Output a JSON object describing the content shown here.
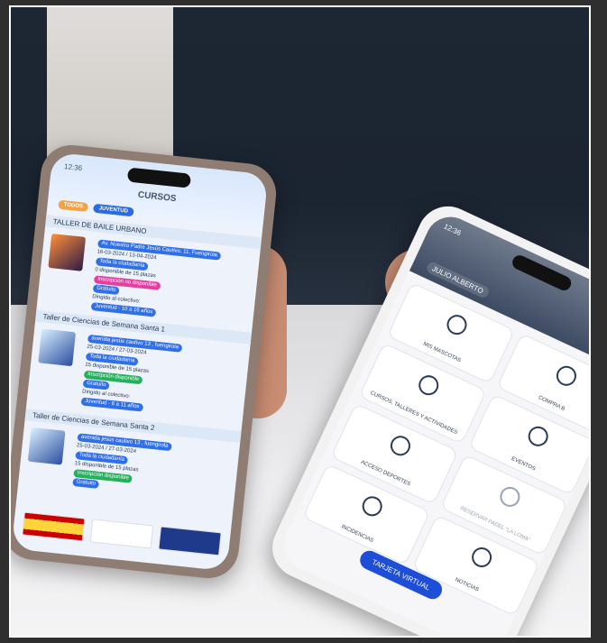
{
  "left_phone": {
    "status_time": "12:36",
    "screen_title": "CURSOS",
    "filters": [
      "TODOS",
      "JUVENTUD"
    ],
    "courses": [
      {
        "title": "TALLER DE BAILE URBANO",
        "location": "Av. Nuestro Padre Jesús Cautivo, 11, Fuengirola",
        "dates": "16-03-2024 / 13-04-2024",
        "audience": "Toda la ciudadanía",
        "places": "0 disponible de 15 plazas",
        "status": "Inscripción no disponible",
        "price": "Gratuito",
        "target_label": "Dirigido al colectivo:",
        "target_group": "Juventud - 10 a 16 años"
      },
      {
        "title": "Taller de Ciencias de Semana Santa 1",
        "location": "avenida jesús cautivo 13 , fuengirola",
        "dates": "25-03-2024 / 27-03-2024",
        "audience": "Toda la ciudadanía",
        "places": "15 disponible de 15 plazas",
        "status": "Inscripción disponible",
        "price": "Gratuito",
        "target_label": "Dirigido al colectivo:",
        "target_group": "Juventud - 6 a 11 años"
      },
      {
        "title": "Taller de Ciencias de Semana Santa 2",
        "location": "avenida jesús cautivo 13 , fuengirola",
        "dates": "25-03-2024 / 27-03-2024",
        "audience": "Toda la ciudadanía",
        "places": "15 disponible de 15 plazas",
        "status": "Inscripción disponible",
        "price": "Gratuito"
      }
    ]
  },
  "right_phone": {
    "status_time": "12:36",
    "user_name": "JULIO ALBERTO",
    "tiles": [
      {
        "label": "MIS MASCOTAS",
        "icon": "paw-icon"
      },
      {
        "label": "COMPRA B",
        "icon": "cart-icon"
      },
      {
        "label": "CURSOS, TALLERES Y ACTIVIDADES",
        "icon": "megaphone-icon"
      },
      {
        "label": "EVENTOS",
        "icon": "calendar-icon"
      },
      {
        "label": "ACCESO DEPORTES",
        "icon": "ball-icon"
      },
      {
        "label": "RESERVAR PADEL \"LA LOMA\"",
        "icon": "racket-icon"
      },
      {
        "label": "INCIDENCIAS",
        "icon": "warning-icon"
      },
      {
        "label": "NOTICIAS",
        "icon": "newspaper-icon"
      }
    ],
    "cta_label": "TARJETA VIRTUAL"
  },
  "colors": {
    "primary_blue": "#2f6fe7",
    "orange": "#f5a245",
    "pink": "#e33ea2",
    "green": "#25b05b"
  }
}
